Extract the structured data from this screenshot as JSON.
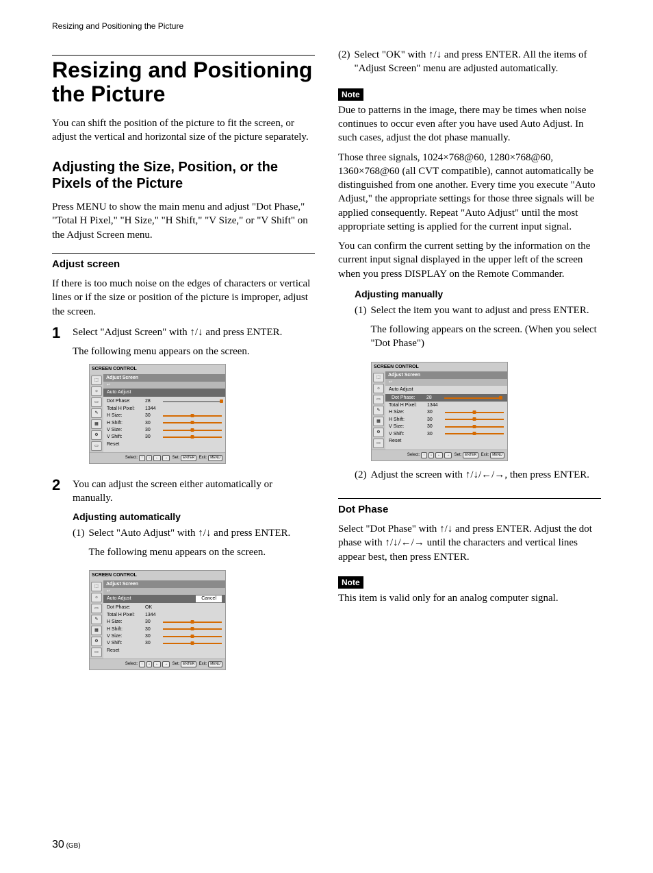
{
  "running_head": "Resizing and Positioning the Picture",
  "title": "Resizing and Positioning the Picture",
  "intro": "You can shift the position of the picture to fit the screen, or adjust the vertical and horizontal size of the picture separately.",
  "section_adjust": {
    "heading": "Adjusting the Size, Position, or the Pixels of the Picture",
    "body": "Press MENU to show the main menu and adjust \"Dot Phase,\" \"Total H Pixel,\" \"H Size,\" \"H Shift,\" \"V Size,\" or \"V Shift\" on the Adjust Screen menu."
  },
  "adjust_screen": {
    "heading": "Adjust screen",
    "intro": "If there is too much noise on the edges of characters or vertical lines or if the size or position of the picture is improper, adjust the screen.",
    "step1_a": "Select \"Adjust Screen\" with ",
    "step1_b": " and press ENTER.",
    "step1_c": "The following menu appears on the screen.",
    "step2": "You can adjust the screen either automatically or manually.",
    "auto_head": "Adjusting automatically",
    "auto1_a": "Select \"Auto Adjust\" with ",
    "auto1_b": " and press ENTER.",
    "auto1_c": "The following menu appears on the screen.",
    "auto2_a": "Select \"OK\" with ",
    "auto2_b": " and press ENTER. All the items of \"Adjust Screen\" menu are adjusted automatically."
  },
  "note": {
    "label": "Note",
    "body1": "Due to patterns in the image, there may be times when noise continues to occur even after you have used Auto Adjust. In such cases, adjust the dot phase manually.",
    "body2": "Those three signals, 1024×768@60, 1280×768@60, 1360×768@60 (all CVT compatible), cannot automatically be distinguished from one another. Every time you execute \"Auto Adjust,\" the appropriate settings for those three signals will be applied consequently. Repeat \"Auto Adjust\" until the most appropriate setting is applied for the current input signal.",
    "body3": "You can confirm the current setting by the information on the current input signal displayed in the upper left of the screen when you press DISPLAY on the Remote Commander."
  },
  "manual": {
    "heading": "Adjusting manually",
    "item1_a": "Select the item you want to adjust and press ENTER.",
    "item1_b": "The following appears on the screen. (When you select \"Dot Phase\")",
    "item2_a": "Adjust the screen with ",
    "item2_b": ", then press ENTER."
  },
  "dot_phase": {
    "heading": "Dot Phase",
    "body_a": "Select \"Dot Phase\" with ",
    "body_b": " and press ENTER. Adjust the dot phase with ",
    "body_c": " until the characters and vertical lines appear best, then press ENTER.",
    "note": "This item is valid only for an analog computer signal."
  },
  "osd": {
    "title": "SCREEN CONTROL",
    "tab": "Adjust Screen",
    "back": "↩",
    "auto_adjust": "Auto Adjust",
    "cancel": "Cancel",
    "ok": "OK",
    "rows": [
      {
        "label": "Dot Phase:",
        "value": "28"
      },
      {
        "label": "Total H Pixel:",
        "value": "1344"
      },
      {
        "label": "H Size:",
        "value": "30"
      },
      {
        "label": "H Shift:",
        "value": "30"
      },
      {
        "label": "V Size:",
        "value": "30"
      },
      {
        "label": "V Shift:",
        "value": "30"
      }
    ],
    "reset": "Reset",
    "bottom_select": "Select:",
    "bottom_set": "Set:",
    "bottom_exit": "Exit:",
    "key_enter": "ENTER",
    "key_menu": "MENU"
  },
  "arrows": {
    "ud": "↑/↓",
    "udlr": "↑/↓/←/→"
  },
  "footer": {
    "page": "30",
    "gb": " (GB)"
  }
}
